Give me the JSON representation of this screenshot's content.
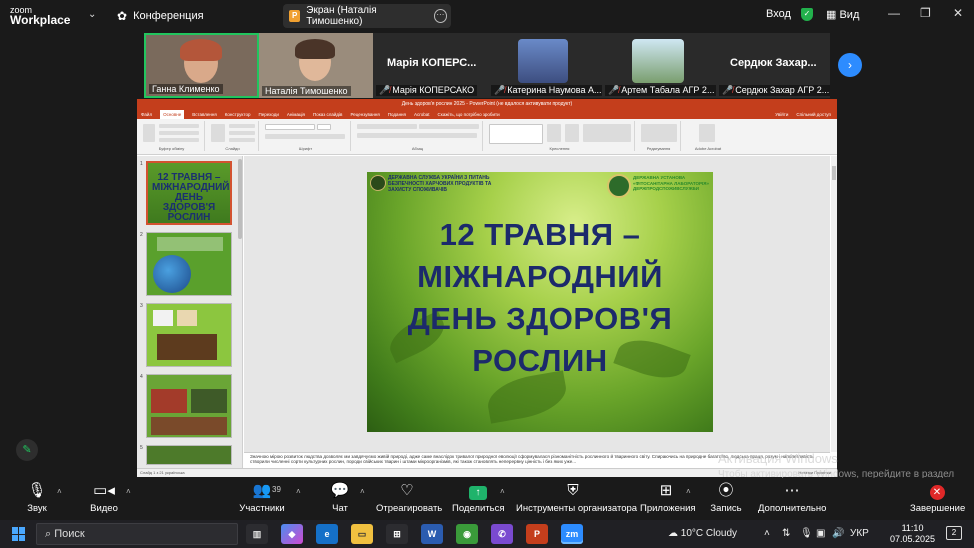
{
  "app": {
    "logo_line1": "zoom",
    "logo_line2": "Workplace",
    "meeting_label": "Конференция",
    "share_title": "Экран (Наталія Тимошенко)",
    "signin_label": "Вход",
    "view_label": "Вид"
  },
  "participants": [
    {
      "name": "Ганна Клименко",
      "muted": false,
      "active": true
    },
    {
      "name": "Наталія Тимошенко",
      "muted": false,
      "active": false
    },
    {
      "name": "Марія КОПЕРСАКО",
      "big_label": "Марія КОПЕРС...",
      "muted": true
    },
    {
      "name": "Катерина Наумова А...",
      "muted": true
    },
    {
      "name": "Артем Табала АГР 2...",
      "muted": true
    },
    {
      "name": "Сердюк Захар АГР 2...",
      "big_label": "Сердюк Захар...",
      "muted": true
    }
  ],
  "powerpoint": {
    "window_title": "День здоров'я рослин 2025 - PowerPoint (не вдалося активувати продукт)",
    "tabs": [
      "Файл",
      "Основне",
      "Вставлення",
      "Конструктор",
      "Переходи",
      "Анімація",
      "Показ слайдів",
      "Рецензування",
      "Подання",
      "Acrobat",
      "Скажіть, що потрібно зробити"
    ],
    "tabs_right": [
      "Увійти",
      "Спільний доступ"
    ],
    "ribbon_groups": [
      "Буфер обміну",
      "Слайди",
      "Шрифт",
      "Абзац",
      "Креслення",
      "Редагування",
      "Adobe Acrobat"
    ],
    "slide": {
      "left_org": "ДЕРЖАВНА СЛУЖБА УКРАЇНИ З ПИТАНЬ БЕЗПЕЧНОСТІ ХАРЧОВИХ ПРОДУКТІВ ТА ЗАХИСТУ СПОЖИВАЧІВ",
      "right_org": "ДЕРЖАВНА УСТАНОВА «ФІТОСАНІТАРНА ЛАБОРАТОРІЯ» ДЕРЖПРОДСПОЖИВСЛУЖБИ",
      "headline_lines": [
        "12 ТРАВНЯ –",
        "МІЖНАРОДНИЙ",
        "ДЕНЬ ЗДОРОВ'Я",
        "РОСЛИН"
      ]
    },
    "thumb1_text": "12 ТРАВНЯ – МІЖНАРОДНИЙ ДЕНЬ ЗДОРОВ'Я РОСЛИН",
    "thumb_numbers": [
      "1",
      "2",
      "3",
      "4",
      "5"
    ],
    "notes": "Значною мірою розвиток людства дозволяє ми завдячуємо живій природі, адже саме внаслідок тривалої природної еволюції сформувалася різноманітність рослинного й тваринного світу. Спираючись на природне багатство, людська праця, розум і наполегливість створили численні сорти культурних рослин, породи свійських тварин і штами мікроорганізмів, які також становлять неперервну цінність і без яких уже...",
    "status_left": "Слайд 1 з 21    українська",
    "status_right": "Нотатки   Примітки"
  },
  "watermark": {
    "line1": "Активация Windows",
    "line2": "Чтобы активировать Windows, перейдите в раздел \"Параметры\"."
  },
  "toolbar": {
    "audio": "Звук",
    "video": "Видео",
    "participants": "Участники",
    "participants_count": "39",
    "chat": "Чат",
    "react": "Отреагировать",
    "share": "Поделиться",
    "host_tools": "Инструменты организатора",
    "apps": "Приложения",
    "record": "Запись",
    "more": "Дополнительно",
    "end": "Завершение"
  },
  "taskbar": {
    "search_placeholder": "Поиск",
    "weather": "10°C  Cloudy",
    "lang": "УКР",
    "time": "11:10",
    "date": "07.05.2025",
    "notifications": "2"
  },
  "colors": {
    "zoom_blue": "#2d8cff",
    "share_green": "#1fb36b",
    "end_red": "#e02828",
    "ppt_orange": "#c43e1c",
    "slide_text": "#1c2a6b"
  }
}
